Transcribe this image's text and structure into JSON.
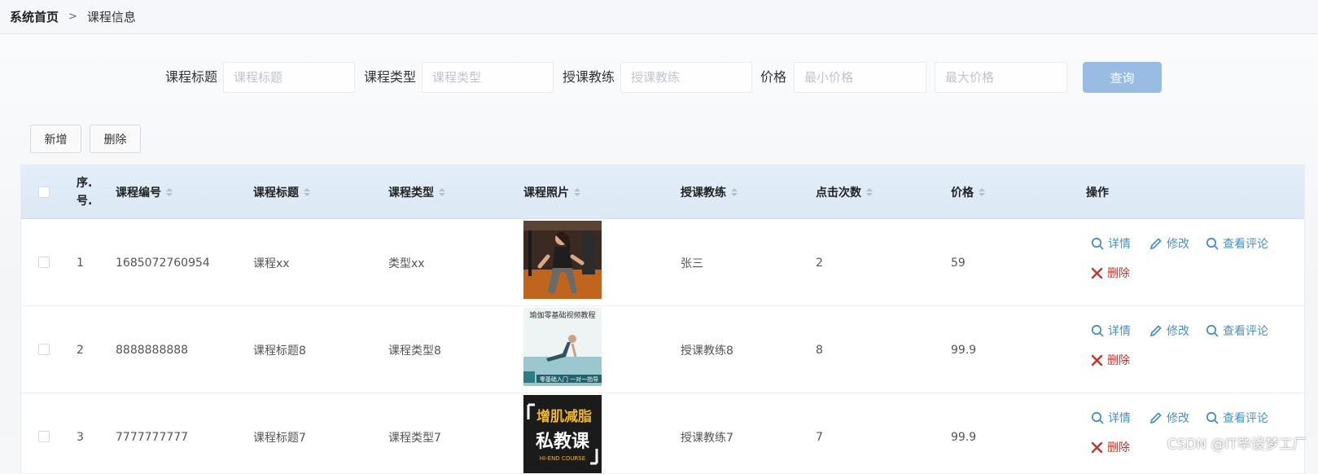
{
  "breadcrumb": {
    "home": "系统首页",
    "separator": ">",
    "current": "课程信息"
  },
  "search": {
    "title_label": "课程标题",
    "title_placeholder": "课程标题",
    "type_label": "课程类型",
    "type_placeholder": "课程类型",
    "coach_label": "授课教练",
    "coach_placeholder": "授课教练",
    "price_label": "价格",
    "price_min_placeholder": "最小价格",
    "price_max_placeholder": "最大价格",
    "query_button": "查询"
  },
  "toolbar": {
    "add_button": "新增",
    "delete_button": "删除"
  },
  "table": {
    "columns": {
      "seq_top": "序.",
      "seq_bottom": "号.",
      "code": "课程编号",
      "title": "课程标题",
      "type": "课程类型",
      "photo": "课程照片",
      "coach": "授课教练",
      "clicks": "点击次数",
      "price": "价格",
      "actions": "操作"
    },
    "rows": [
      {
        "seq": "1",
        "code": "1685072760954",
        "title": "课程xx",
        "type": "类型xx",
        "coach": "张三",
        "clicks": "2",
        "price": "59",
        "photo_icon": "fitness-photo-icon"
      },
      {
        "seq": "2",
        "code": "8888888888",
        "title": "课程标题8",
        "type": "课程类型8",
        "coach": "授课教练8",
        "clicks": "8",
        "price": "99.9",
        "photo_icon": "yoga-photo-icon"
      },
      {
        "seq": "3",
        "code": "7777777777",
        "title": "课程标题7",
        "type": "课程类型7",
        "coach": "授课教练7",
        "clicks": "7",
        "price": "99.9",
        "photo_icon": "private-course-poster-icon"
      }
    ],
    "row_actions": {
      "detail": "详情",
      "edit": "修改",
      "view_comments": "查看评论",
      "delete": "删除"
    }
  },
  "poster_text": {
    "yoga_title": "瑜伽零基础视频教程",
    "yoga_badge": "零基础入门 一对一指导",
    "private_line1": "增肌减脂",
    "private_line2": "私教课",
    "private_line3": "HI-END COURSE"
  },
  "watermark": "CSDN @IT毕设梦工厂",
  "colors": {
    "accent": "#4a8fbf",
    "danger": "#c4332b",
    "query_button": "#99bce3",
    "header_bg": "#dbe9f5"
  }
}
